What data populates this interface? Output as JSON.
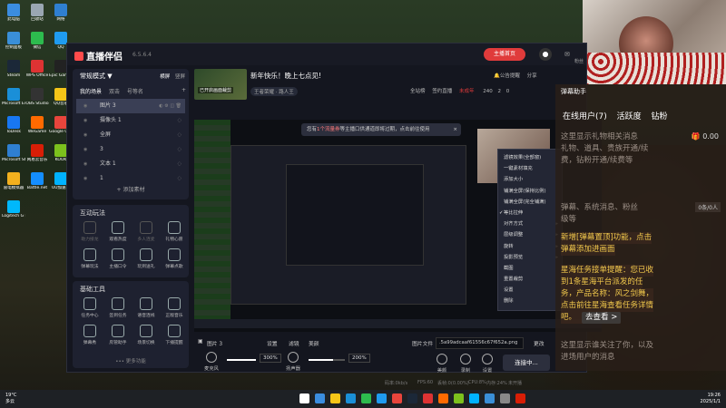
{
  "desktop": {
    "icons": [
      {
        "label": "此电脑",
        "color": "#3b8de0"
      },
      {
        "label": "回收站",
        "color": "#9aa6b2"
      },
      {
        "label": "网络",
        "color": "#2f7fd1"
      },
      {
        "label": "控制面板",
        "color": "#3a8fd8"
      },
      {
        "label": "微信",
        "color": "#2dbb4e"
      },
      {
        "label": "QQ",
        "color": "#1f9bf0"
      },
      {
        "label": "Steam",
        "color": "#1b2838"
      },
      {
        "label": "WPS Office",
        "color": "#d33"
      },
      {
        "label": "Epic Games Launcher",
        "color": "#222"
      },
      {
        "label": "Microsoft Edge",
        "color": "#1a8fd8"
      },
      {
        "label": "OBS Studio",
        "color": "#333"
      },
      {
        "label": "QQ音乐",
        "color": "#f5c518"
      },
      {
        "label": "ToDesk",
        "color": "#1877f2"
      },
      {
        "label": "WeGame",
        "color": "#ff6a00"
      },
      {
        "label": "Google Chrome",
        "color": "#e8453c"
      },
      {
        "label": "Microsoft Store",
        "color": "#2f7fd1"
      },
      {
        "label": "网易云音乐",
        "color": "#d81e06"
      },
      {
        "label": "KOOK",
        "color": "#7cc11d"
      },
      {
        "label": "雷电模拟器",
        "color": "#f2b01e"
      },
      {
        "label": "Battle.net",
        "color": "#148eff"
      },
      {
        "label": "UU加速器",
        "color": "#00b2ff"
      },
      {
        "label": "Logitech G HUB",
        "color": "#00b8fc"
      }
    ]
  },
  "app": {
    "name": "直播伴侣",
    "version": "6.5.6.4",
    "top_button": "主播首页",
    "fans_label": "粉丝",
    "left": {
      "mode": "常规模式 ▼",
      "mode_options": [
        "横屏",
        "竖屏"
      ],
      "scene_tabs": [
        "我的场景",
        "双击",
        "号等名"
      ],
      "sources": [
        {
          "name": "图片 3",
          "selected": true
        },
        {
          "name": "摄像头 1",
          "selected": false
        },
        {
          "name": "全屏",
          "selected": false
        },
        {
          "name": "3",
          "selected": false
        },
        {
          "name": "文本 1",
          "selected": false
        },
        {
          "name": "1",
          "selected": false
        }
      ],
      "add_material": "+ 添加素材",
      "interactive_title": "互动玩法",
      "interactive_tools": [
        {
          "label": "助力接龙",
          "dim": true
        },
        {
          "label": "观看热度",
          "dim": false
        },
        {
          "label": "多人连麦",
          "dim": true
        },
        {
          "label": "礼物心愿",
          "dim": false
        },
        {
          "label": "弹幕玩法",
          "dim": false
        },
        {
          "label": "主播口令",
          "dim": false
        },
        {
          "label": "玩到送礼",
          "dim": false
        },
        {
          "label": "弹幕点歌",
          "dim": false
        }
      ],
      "basic_title": "基础工具",
      "basic_tools": [
        {
          "label": "任务中心",
          "dim": false
        },
        {
          "label": "签到任务",
          "dim": false
        },
        {
          "label": "语音连线",
          "dim": false
        },
        {
          "label": "正版音乐",
          "dim": false
        },
        {
          "label": "弹幕秀",
          "dim": false
        },
        {
          "label": "房管助手",
          "dim": false
        },
        {
          "label": "场景切换",
          "dim": false
        },
        {
          "label": "下播提醒",
          "dim": false
        }
      ],
      "more": "••• 更多功能"
    },
    "center": {
      "thumb_caption": "已开启画面裁剪",
      "room_title": "新年快乐！晚上七点见!",
      "room_tag": "王者荣耀 · 路人王",
      "tools": [
        "公告提醒",
        "分享",
        "全站榜",
        "签约直播",
        "未成年"
      ],
      "stats": [
        "240",
        "2",
        "0"
      ],
      "toast_prefix": "您有",
      "toast_highlight": "1个流量券",
      "toast_suffix": "等主播口供通道即将过期，点击前往使用",
      "context_menu": [
        {
          "label": "滤镜效果(全部窗)",
          "arrow": false,
          "check": false
        },
        {
          "label": "一键素材填充",
          "arrow": false,
          "check": false
        },
        {
          "label": "添加大小",
          "arrow": false,
          "check": false
        },
        {
          "label": "铺满全屏(保持比例)",
          "arrow": false,
          "check": false
        },
        {
          "label": "铺满全屏(完全铺满)",
          "arrow": false,
          "check": false
        },
        {
          "label": "等比拉伸",
          "arrow": false,
          "check": true
        },
        {
          "label": "对齐方式",
          "arrow": true,
          "check": false
        },
        {
          "label": "层级调整",
          "arrow": true,
          "check": false
        },
        {
          "label": "旋转",
          "arrow": true,
          "check": false
        },
        {
          "label": "投影预览",
          "arrow": true,
          "check": false
        },
        {
          "label": "截图",
          "arrow": false,
          "check": false
        },
        {
          "label": "重置裁剪",
          "arrow": false,
          "check": false
        },
        {
          "label": "设置",
          "arrow": false,
          "check": false
        },
        {
          "label": "删除",
          "arrow": false,
          "check": false
        }
      ],
      "layer_name": "图片 3",
      "layer_actions": [
        "设置",
        "滤镜",
        "美颜"
      ],
      "file_label": "图片文件",
      "file_value": ".5a99adcaaf61556c67f652a.png",
      "change_label": "更改",
      "mic_label": "麦克风",
      "mic_value": "300%",
      "mic_level": 1.0,
      "speaker_label": "扬声器",
      "speaker_value": "200%",
      "speaker_level": 0.67,
      "tool_buttons": [
        "美颜",
        "录制",
        "设置"
      ],
      "start_button": "连接中...",
      "status": [
        "码率:0kb/s",
        "FPS:60",
        "丢帧:0(0.00%)",
        "CPU:8%",
        "内存:24%",
        "未开播"
      ]
    }
  },
  "danmu": {
    "title": "弹幕助手",
    "tabs": [
      "在线用户(7)",
      "活跃度",
      "钻粉"
    ],
    "lines": [
      {
        "text": "这里显示礼物相关消息",
        "hl": false
      },
      {
        "text": "礼物、道具、贵族开通/续",
        "hl": false
      },
      {
        "text": "费，钻粉开通/续费等",
        "hl": false
      },
      {
        "text": "弹幕、系统消息、粉丝",
        "hl": false
      },
      {
        "text": "级等",
        "hl": false
      },
      {
        "text": "新增[弹幕置顶]功能，点击",
        "hl": true
      },
      {
        "text": "弹幕添加进画面",
        "hl": true
      },
      {
        "text": "星海任务接单提醒：您已收",
        "hl": true
      },
      {
        "text": "到1条星海平台派发的任",
        "hl": true
      },
      {
        "text": "务，产品名称：风之剑舞，",
        "hl": true
      },
      {
        "text": "点击前往星海查看任务详情",
        "hl": true
      },
      {
        "text": "吧。",
        "hl": true
      },
      {
        "text": "这里显示谁关注了你，以及",
        "hl": false
      },
      {
        "text": "进场用户的消息",
        "hl": false
      }
    ],
    "goto_button": "去查看 >",
    "gift_count": "0.00",
    "online_badge": "0条/0人"
  },
  "taskbar": {
    "weather_temp": "19°C",
    "weather_desc": "多云",
    "time": "19:26",
    "date": "2025/1/1"
  }
}
